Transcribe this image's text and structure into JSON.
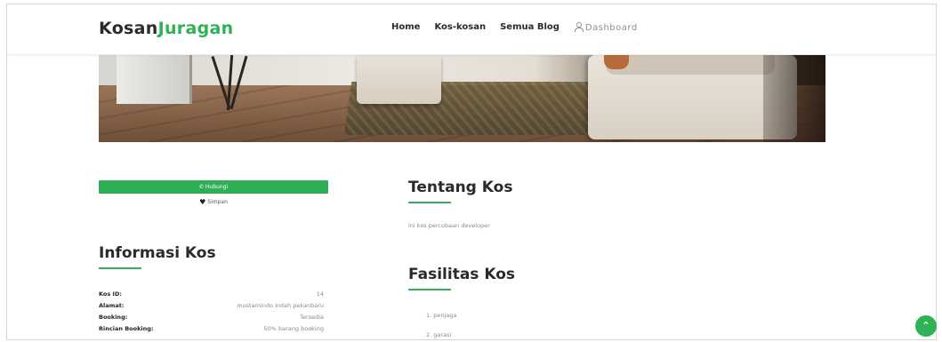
{
  "brand": {
    "part1": "Kosan",
    "part2": "Juragan"
  },
  "nav": {
    "items": [
      {
        "label": "Home"
      },
      {
        "label": "Kos-kosan"
      },
      {
        "label": "Semua Blog"
      }
    ],
    "dashboard": "Dashboard"
  },
  "sidebar": {
    "contact_label": "Hubungi",
    "save_label": "Simpan"
  },
  "info": {
    "title": "Informasi Kos",
    "rows": [
      {
        "key": "Kos ID:",
        "value": "14"
      },
      {
        "key": "Alamat:",
        "value": "mustamindo indah pekanbaru"
      },
      {
        "key": "Booking:",
        "value": "Tersedia"
      },
      {
        "key": "Rincian Booking:",
        "value": "50% barang booking"
      }
    ]
  },
  "about": {
    "title": "Tentang Kos",
    "text": "ini kos percobaan developer"
  },
  "facilities": {
    "title": "Fasilitas Kos",
    "items": [
      "1. penjaga",
      "2. garasi"
    ]
  },
  "colors": {
    "accent": "#2fb158",
    "button": "#2eae55"
  }
}
